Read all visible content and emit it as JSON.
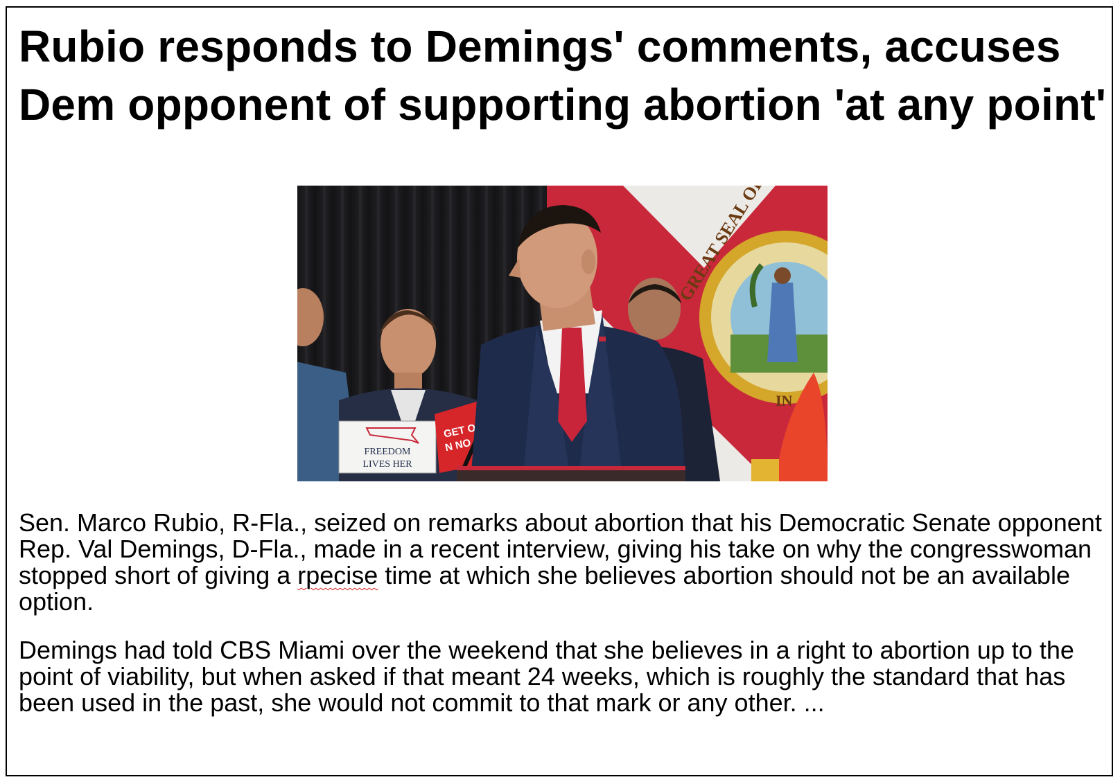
{
  "article": {
    "headline": "Rubio responds to Demings' comments, accuses Dem opponent of supporting abortion 'at any point'",
    "photo": {
      "sign_line1": "FREEDOM",
      "sign_line2": "LIVES HER",
      "red_sign_line1": "GET OUT",
      "red_sign_line2": "N NO",
      "seal_text": "GREAT SEAL OF TH",
      "seal_bottom": "IN"
    },
    "paragraph1": {
      "before_typo": "Sen. Marco Rubio, R-Fla., seized on remarks about abortion that his Democratic Senate opponent Rep. Val Demings, D-Fla., made in a recent interview, giving his take on why the congresswoman stopped short of giving a ",
      "typo": "rpecise",
      "after_typo": " time at which she believes abortion should not be an available option."
    },
    "paragraph2": "Demings had told CBS Miami over the weekend that she believes in a right to abortion up to the point of viability, but when asked if that meant 24 weeks, which is roughly the standard that has been used in the past, she would not commit to that mark or any other. ..."
  },
  "colors": {
    "flag_red": "#c8283a",
    "suit_navy": "#1f2b4a",
    "tie_red": "#c8243a",
    "curtain": "#1a1a1d",
    "spellcheck_underline": "#d21f1f"
  }
}
